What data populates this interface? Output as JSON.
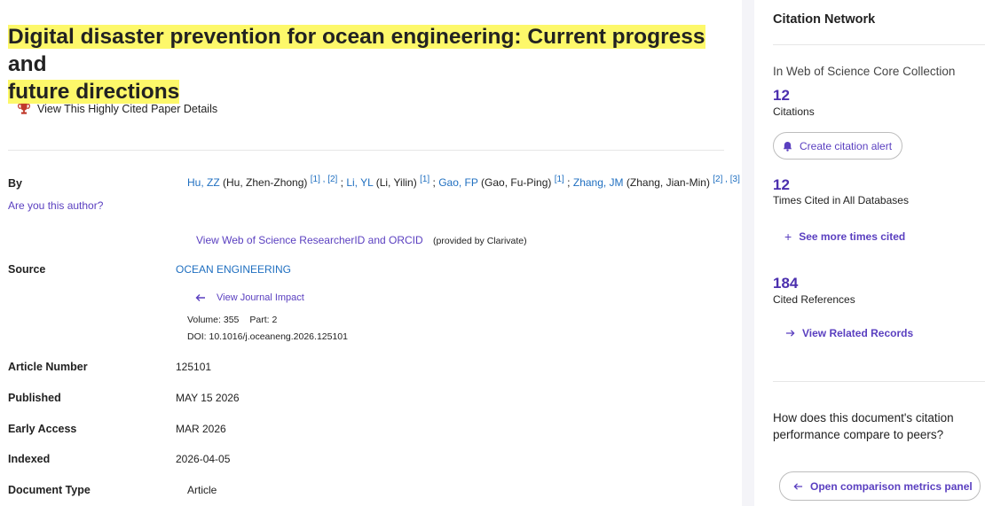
{
  "record": {
    "title_highlighted": "Digital disaster prevention for ocean engineering: Current progress",
    "title_line1_rest": " and",
    "title_line2": "future directions",
    "highly_cited_label": "View This Highly Cited Paper Details"
  },
  "labels": {
    "by": "By",
    "are_you_author": "Are you this author?",
    "source": "Source",
    "article_number": "Article Number",
    "published": "Published",
    "early_access": "Early Access",
    "indexed": "Indexed",
    "document_type": "Document Type"
  },
  "authors": [
    {
      "short": "Hu, ZZ",
      "full": "(Hu, Zhen-Zhong)",
      "refs": "[1] , [2]"
    },
    {
      "short": "Li, YL",
      "full": "(Li, Yilin)",
      "refs": "[1]"
    },
    {
      "short": "Gao, FP",
      "full": "(Gao, Fu-Ping)",
      "refs": "[1]"
    },
    {
      "short": "Zhang, JM",
      "full": "(Zhang, Jian-Min)",
      "refs": "[2] , [3]"
    }
  ],
  "author_sep": " ; ",
  "researcher_link": "View Web of Science ResearcherID and ORCID",
  "provided_by": "(provided by Clarivate)",
  "source": {
    "journal": "OCEAN ENGINEERING",
    "journal_impact": "View Journal Impact",
    "volume": "Volume: 355",
    "part": "Part: 2",
    "doi": "DOI: 10.1016/j.oceaneng.2026.125101"
  },
  "values": {
    "article_number": "125101",
    "published": "MAY 15 2026",
    "early_access": "MAR 2026",
    "indexed": "2026-04-05",
    "document_type": "Article"
  },
  "sidebar": {
    "title": "Citation Network",
    "collection": "In Web of Science Core Collection",
    "citations_count": "12",
    "citations_label": "Citations",
    "create_alert": "Create citation alert",
    "times_cited_count": "12",
    "times_cited_label": "Times Cited in All Databases",
    "see_more": "See more times cited",
    "cited_refs_count": "184",
    "cited_refs_label": "Cited References",
    "view_related": "View Related Records",
    "question": "How does this document's citation performance compare to peers?",
    "open_comparison": "Open comparison metrics panel"
  },
  "colors": {
    "accent": "#5a3fc0",
    "link": "#1f6fc0",
    "highlight": "#fdf86a",
    "trophy": "#c0392b"
  },
  "icons": [
    "trophy-icon",
    "bell-icon",
    "arrow-left-icon",
    "plus-icon",
    "arrow-right-icon"
  ]
}
